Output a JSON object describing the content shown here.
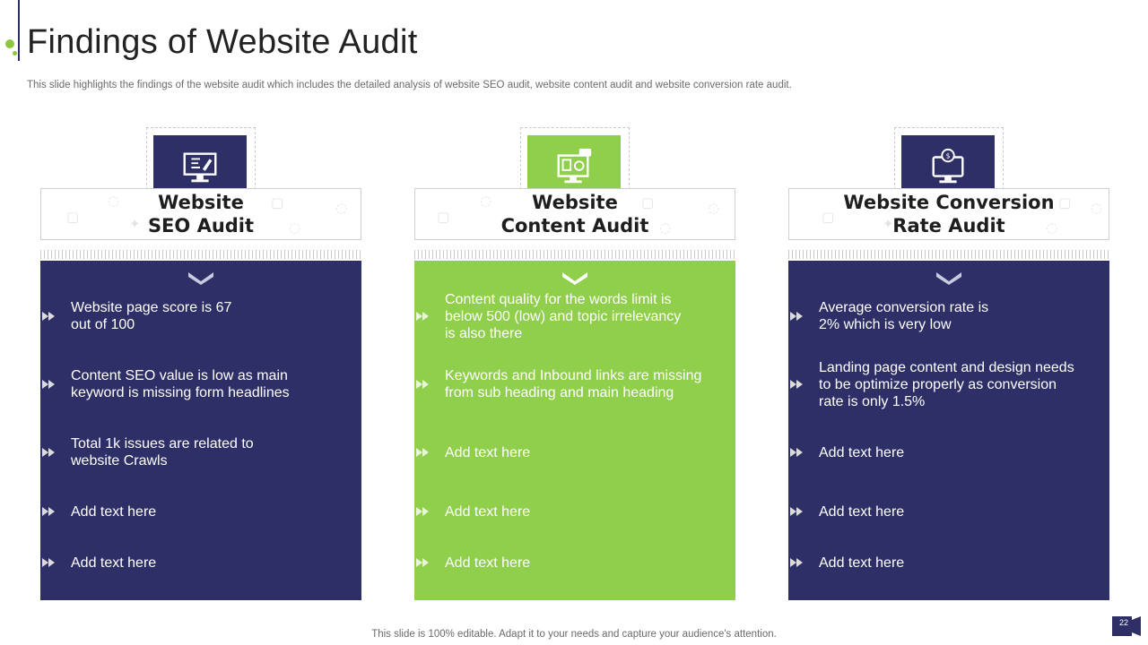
{
  "slide": {
    "title": "Findings of Website  Audit",
    "subtitle": "This slide highlights the findings of the website audit which includes the detailed analysis of website SEO audit, website content audit and website conversion rate audit.",
    "footer": "This slide is 100% editable. Adapt it to your needs and capture your audience's attention.",
    "page_number": "22"
  },
  "colors": {
    "navy": "#2d2f66",
    "green": "#8fcf4b",
    "accent_green": "#8cc63f"
  },
  "columns": [
    {
      "title": "Website\nSEO Audit",
      "icon": "seo-monitor-icon",
      "theme": "navy",
      "bullets": [
        "Website page score is 67\nout of 100",
        "Content SEO value is low as main\nkeyword is missing form headlines",
        "Total 1k issues are related to\nwebsite  Crawls",
        "Add text here",
        "Add text here"
      ]
    },
    {
      "title": "Website\nContent Audit",
      "icon": "content-monitor-icon",
      "theme": "green",
      "bullets": [
        "Content quality for the words limit is\nbelow 500 (low) and topic irrelevancy\nis also there",
        "Keywords and Inbound  links are missing\nfrom sub heading and main heading",
        "Add text here",
        "Add text here",
        "Add text here"
      ]
    },
    {
      "title": "Website Conversion\nRate Audit",
      "icon": "conversion-monitor-icon",
      "theme": "navy",
      "bullets": [
        "Average conversion rate is\n2% which is very low",
        "Landing page content and design needs\nto be optimize properly as conversion\nrate is only  1.5%",
        "Add text here",
        "Add text here",
        "Add text here"
      ]
    }
  ]
}
